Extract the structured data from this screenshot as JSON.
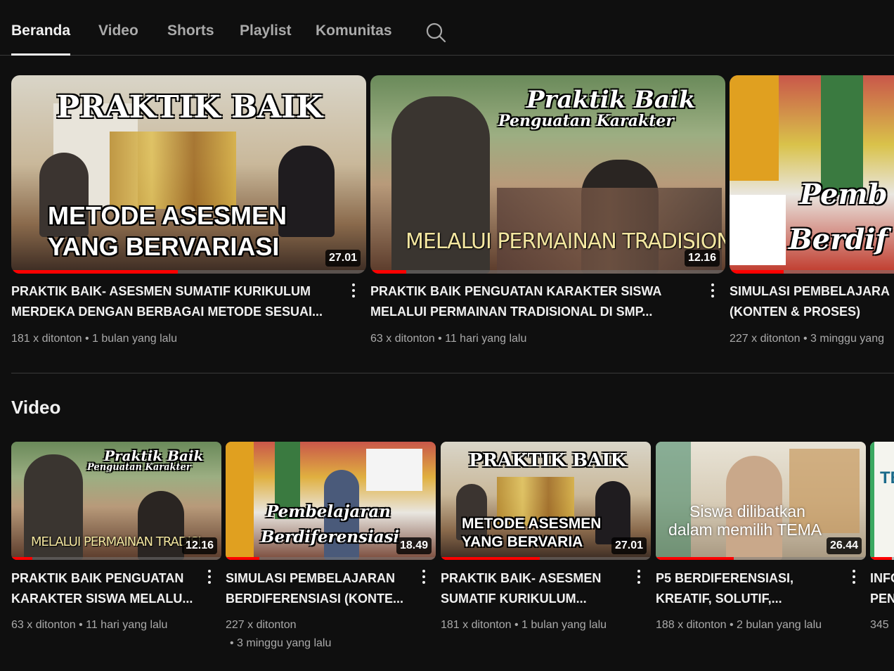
{
  "tabs": [
    "Beranda",
    "Video",
    "Shorts",
    "Playlist",
    "Komunitas"
  ],
  "featured": [
    {
      "caption_top": "PRAKTIK BAIK",
      "caption_bottom_1": "METODE ASESMEN",
      "caption_bottom_2": "YANG BERVARIASI",
      "duration": "27.01",
      "progress": 0.47,
      "title_1": "PRAKTIK BAIK- ASESMEN SUMATIF KURIKULUM",
      "title_2": "MERDEKA DENGAN BERBAGAI METODE SESUAI...",
      "views": "181 x ditonton",
      "age": "1 bulan yang lalu"
    },
    {
      "caption_top": "Praktik Baik",
      "caption_sub": "Penguatan Karakter",
      "caption_bottom_1": "MELALUI PERMAINAN TRADISIONAL",
      "duration": "12.16",
      "progress": 0.1,
      "title_1": "PRAKTIK BAIK PENGUATAN KARAKTER SISWA",
      "title_2": "MELALUI PERMAINAN TRADISIONAL DI SMP...",
      "views": "63 x ditonton",
      "age": "11 hari yang lalu"
    },
    {
      "caption_top": "Pemb",
      "caption_sub": "Berdif",
      "progress": 0.33,
      "title_1": "SIMULASI PEMBELAJARA",
      "title_2": "(KONTEN & PROSES)",
      "views": "227 x ditonton",
      "age": "3 minggu yang"
    }
  ],
  "section": {
    "title": "Video"
  },
  "videos": [
    {
      "caption_top": "Praktik Baik",
      "caption_sub": "Penguatan Karakter",
      "caption_bottom_1": "MELALUI PERMAINAN TRADISI",
      "duration": "12.16",
      "progress": 0.1,
      "title_1": "PRAKTIK BAIK PENGUATAN",
      "title_2": "KARAKTER SISWA MELALU...",
      "views": "63 x ditonton",
      "age": "11 hari yang lalu"
    },
    {
      "caption_top": "Pembelajaran",
      "caption_sub": "Berdiferensiasi",
      "duration": "18.49",
      "progress": 0.16,
      "title_1": "SIMULASI PEMBELAJARAN",
      "title_2": "BERDIFERENSIASI (KONTE...",
      "views": "227 x ditonton",
      "age": "3 minggu yang lalu"
    },
    {
      "caption_top": "PRAKTIK BAIK",
      "caption_bottom_1": "METODE ASESMEN",
      "caption_bottom_2": "YANG BERVARIA",
      "duration": "27.01",
      "progress": 0.47,
      "title_1": "PRAKTIK BAIK- ASESMEN",
      "title_2": "SUMATIF KURIKULUM...",
      "views": "181 x ditonton",
      "age": "1 bulan yang lalu"
    },
    {
      "caption_top": "Siswa dilibatkan",
      "caption_sub": "dalam memilih TEMA",
      "duration": "26.44",
      "progress": 0.37,
      "title_1": "P5 BERDIFERENSIASI,",
      "title_2": "KREATIF, SOLUTIF,...",
      "views": "188 x ditonton",
      "age": "2 bulan yang lalu"
    },
    {
      "caption_top": "TE",
      "progress": 0.9,
      "title_1": "INFO",
      "title_2": "PEN",
      "views": "345"
    }
  ],
  "colors": {
    "background": "#0f0f0f",
    "progress": "#ff0000",
    "text": "#f1f1f1",
    "muted": "#aaaaaa"
  }
}
